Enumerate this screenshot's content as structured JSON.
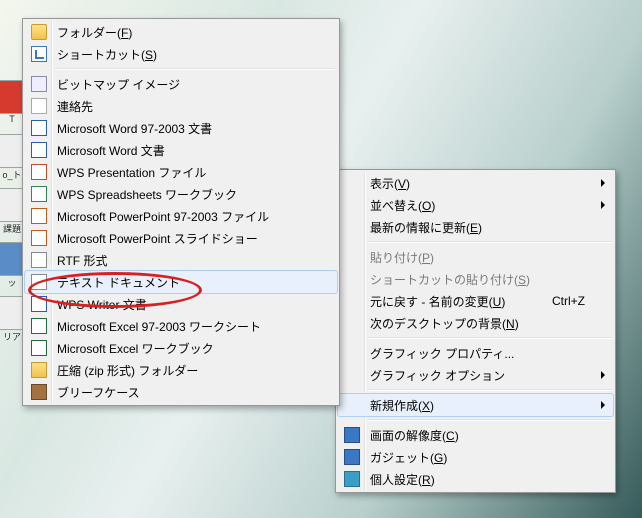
{
  "desktop": {
    "label1": "T",
    "label2": "o_ト",
    "label3": "課題",
    "label4": "ッ",
    "label5": "リア"
  },
  "parent_menu": {
    "view": "表示",
    "view_key": "V",
    "sort": "並べ替え",
    "sort_key": "O",
    "refresh": "最新の情報に更新",
    "refresh_key": "E",
    "paste": "貼り付け",
    "paste_key": "P",
    "paste_shortcut": "ショートカットの貼り付け",
    "paste_shortcut_key": "S",
    "undo": "元に戻す - 名前の変更",
    "undo_key": "U",
    "undo_accel": "Ctrl+Z",
    "next_bg": "次のデスクトップの背景",
    "next_bg_key": "N",
    "gprop": "グラフィック プロパティ...",
    "gopt": "グラフィック オプション",
    "new": "新規作成",
    "new_key": "X",
    "resolution": "画面の解像度",
    "resolution_key": "C",
    "gadget": "ガジェット",
    "gadget_key": "G",
    "personalize": "個人設定",
    "personalize_key": "R"
  },
  "new_menu": {
    "folder": "フォルダー",
    "folder_key": "F",
    "shortcut": "ショートカット",
    "shortcut_key": "S",
    "bitmap": "ビットマップ イメージ",
    "contact": "連絡先",
    "word9703": "Microsoft Word 97-2003 文書",
    "word": "Microsoft Word 文書",
    "wpsp": "WPS Presentation ファイル",
    "wpss": "WPS Spreadsheets ワークブック",
    "ppt9703": "Microsoft PowerPoint 97-2003 ファイル",
    "ppt": "Microsoft PowerPoint スライドショー",
    "rtf": "RTF 形式",
    "text": "テキスト ドキュメント",
    "wpsw": "WPS Writer 文書",
    "xls9703": "Microsoft Excel 97-2003 ワークシート",
    "xls": "Microsoft Excel ワークブック",
    "zip": "圧縮 (zip 形式) フォルダー",
    "briefcase": "ブリーフケース"
  }
}
